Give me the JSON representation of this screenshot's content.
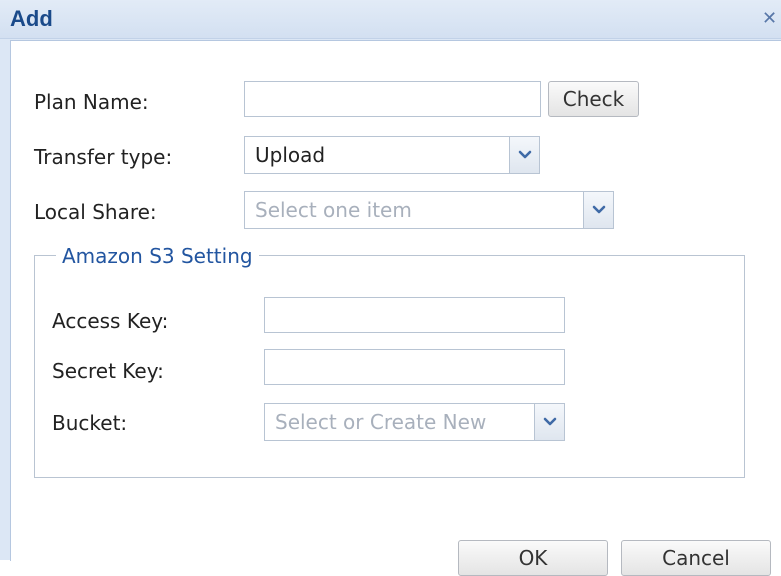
{
  "dialog": {
    "title": "Add",
    "close_glyph": "✕"
  },
  "form": {
    "plan_name": {
      "label": "Plan Name:",
      "value": "",
      "placeholder": ""
    },
    "check_button": "Check",
    "transfer_type": {
      "label": "Transfer type:",
      "value": "Upload"
    },
    "local_share": {
      "label": "Local Share:",
      "placeholder": "Select one item"
    }
  },
  "s3": {
    "legend": "Amazon S3 Setting",
    "access_key": {
      "label": "Access Key:",
      "value": ""
    },
    "secret_key": {
      "label": "Secret Key:",
      "value": ""
    },
    "bucket": {
      "label": "Bucket:",
      "placeholder": "Select or Create New"
    }
  },
  "buttons": {
    "ok": "OK",
    "cancel": "Cancel"
  },
  "colors": {
    "title": "#1a4a8a",
    "legend": "#2255a0",
    "window_bg": "#dce7f5",
    "placeholder": "#a8b0bc"
  },
  "icons": {
    "dropdown": "chevron-down-icon",
    "close": "close-icon"
  }
}
